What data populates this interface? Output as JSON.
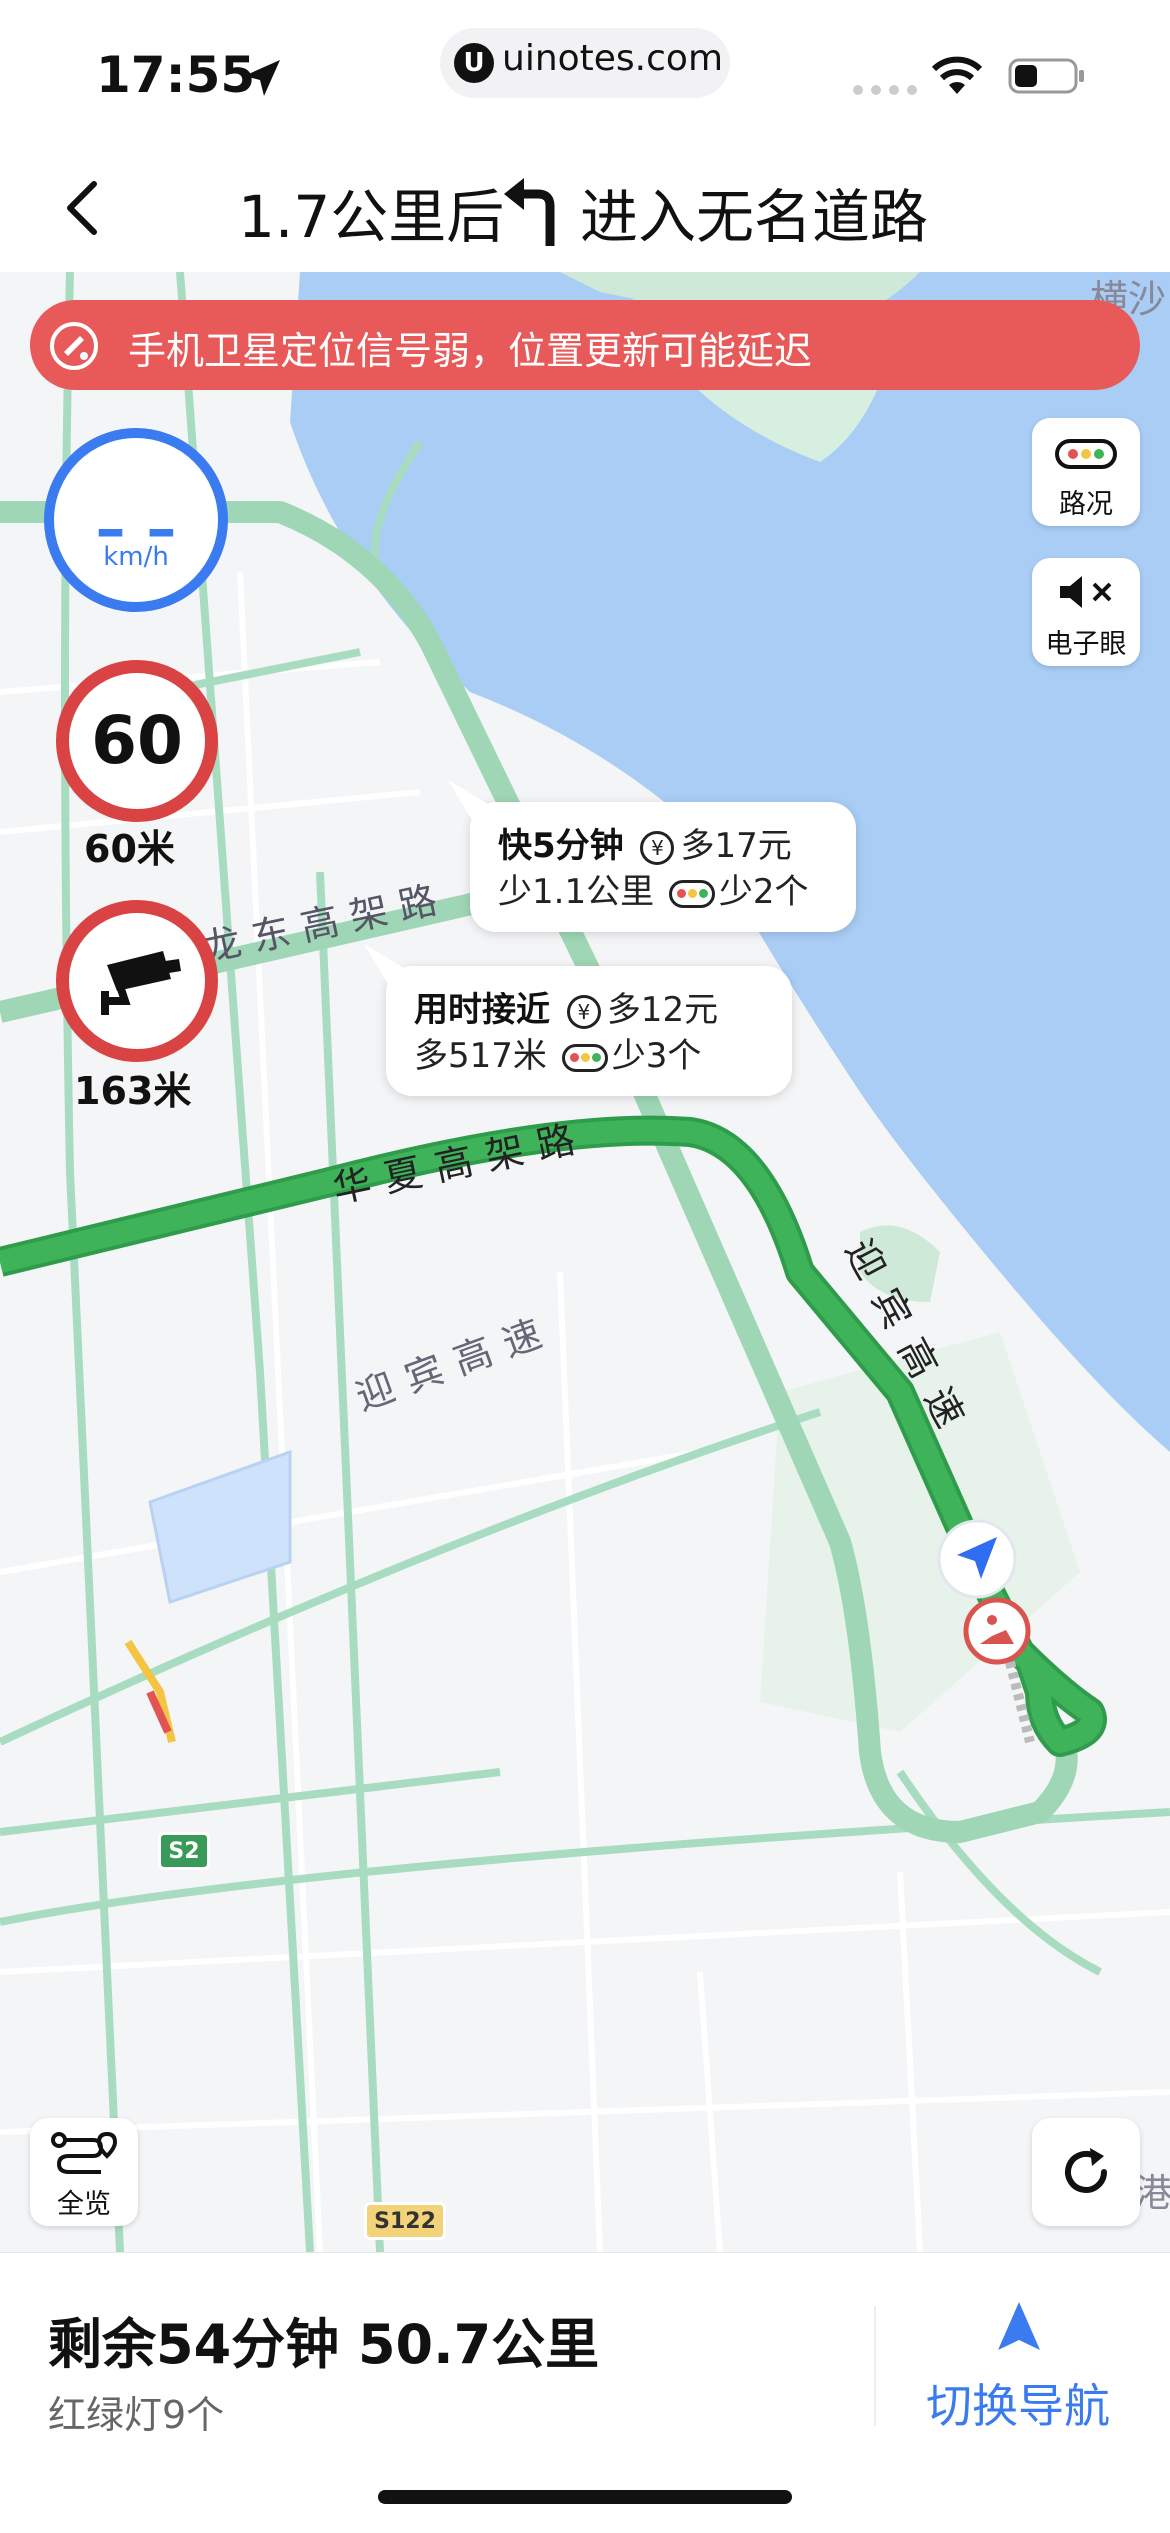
{
  "status_bar": {
    "time": "17:55",
    "url": "uinotes.com"
  },
  "nav": {
    "instruction_distance": "1.7公里后",
    "instruction_action": "进入无名道路"
  },
  "banner": {
    "text": "手机卫星定位信号弱，位置更新可能延迟"
  },
  "speed": {
    "value": "– –",
    "unit": "km/h"
  },
  "speed_limit": {
    "value": "60",
    "distance": "60米"
  },
  "camera": {
    "distance": "163米"
  },
  "side_buttons": {
    "traffic_label": "路况",
    "camera_label": "电子眼"
  },
  "route_options": [
    {
      "title": "快5分钟",
      "cost": "多17元",
      "distance": "少1.1公里",
      "lights": "少2个"
    },
    {
      "title": "用时接近",
      "cost": "多12元",
      "distance": "多517米",
      "lights": "少3个"
    }
  ],
  "road_labels": {
    "huaxia": "华夏高架路",
    "yingbin_main": "迎宾高速",
    "yingbin_secondary": "迎宾高速",
    "longdong": "龙东高架路",
    "top_right": "横沙",
    "bottom_right": "港"
  },
  "shields": {
    "s2": "S2",
    "s122": "S122"
  },
  "map_buttons": {
    "overview_label": "全览"
  },
  "summary": {
    "remaining": "剩余54分钟  50.7公里",
    "traffic_lights": "红绿灯9个",
    "switch_label": "切换导航"
  },
  "colors": {
    "accent": "#3a7bf0",
    "route_green": "#3fb35a",
    "alt_route": "#9fd6b5",
    "water": "#a9cdf5",
    "alert_red": "#e85a5a"
  }
}
